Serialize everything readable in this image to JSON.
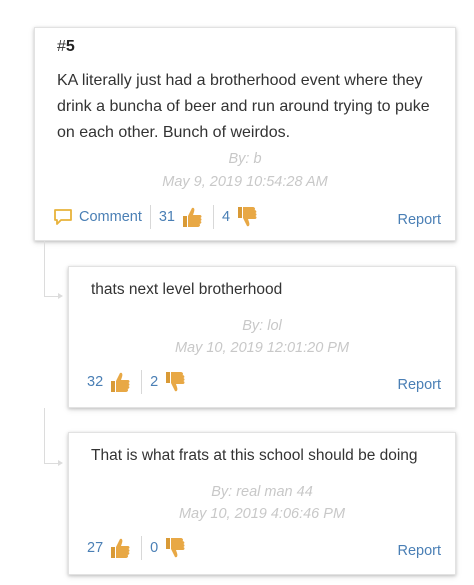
{
  "post": {
    "number_prefix": "#",
    "number": "5",
    "text": "KA literally just had a brotherhood event where they drink a buncha of beer and run around trying to puke on each other. Bunch of weirdos.",
    "author": "By: b",
    "timestamp": "May 9, 2019 10:54:28 AM",
    "comment_label": "Comment",
    "upvotes": "31",
    "downvotes": "4",
    "report_label": "Report"
  },
  "replies": [
    {
      "text": "thats next level brotherhood",
      "author": "By: lol",
      "timestamp": "May 10, 2019 12:01:20 PM",
      "upvotes": "32",
      "downvotes": "2",
      "report_label": "Report"
    },
    {
      "text": "That is what frats at this school should be doing",
      "author": "By: real man 44",
      "timestamp": "May 10, 2019 4:06:46 PM",
      "upvotes": "27",
      "downvotes": "0",
      "report_label": "Report"
    }
  ],
  "colors": {
    "link": "#4a7fb5",
    "meta": "#c8c8c8",
    "comment_icon": "#e8b23a",
    "thumb": "#e8a845"
  },
  "icons": {
    "comment": "speech-bubble-icon",
    "upvote": "thumbs-up-icon",
    "downvote": "thumbs-down-icon"
  }
}
